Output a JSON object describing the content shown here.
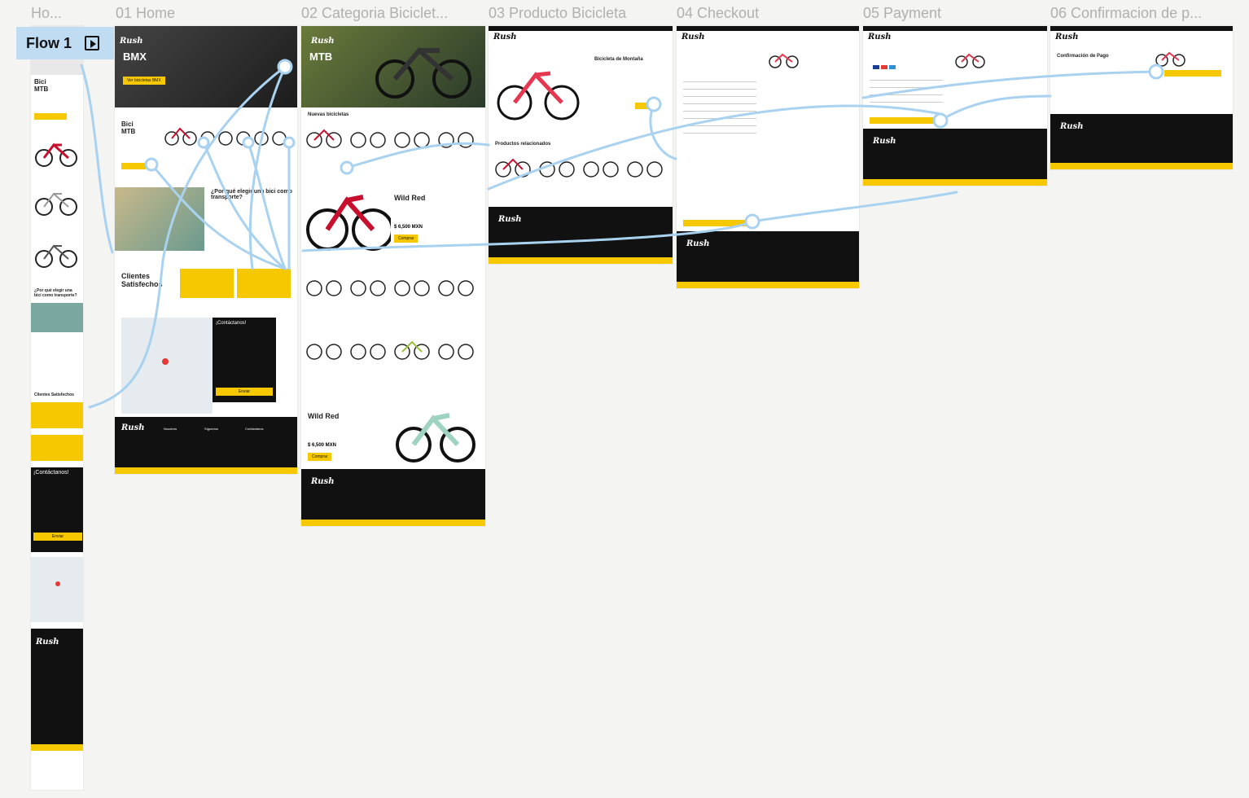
{
  "canvas": {
    "background": "#f4f4f3",
    "accent": "#f6c800",
    "flow_color": "#a9d2f0"
  },
  "flow": {
    "label": "Flow 1",
    "icon": "play-frame-icon"
  },
  "frames": [
    {
      "label": "Ho..."
    },
    {
      "label": "01 Home"
    },
    {
      "label": "02 Categoria Biciclet..."
    },
    {
      "label": "03 Producto Bicicleta"
    },
    {
      "label": "04 Checkout"
    },
    {
      "label": "05 Payment"
    },
    {
      "label": "06 Confirmacion de p..."
    }
  ],
  "brand": {
    "logo": "Rush"
  },
  "mobile": {
    "bici": "Bici",
    "mtb": "MTB",
    "why": "¿Por qué elegir una bici como transporte?",
    "clients": "Clientes Satisfechos",
    "contact": "¡Contáctanos!",
    "send": "Enviar"
  },
  "home": {
    "hero_title": "BMX",
    "hero_btn": "Ver bicicletas BMX",
    "bici": "Bici",
    "mtb": "MTB",
    "why": "¿Por qué elegir una bici como transporte?",
    "clients": "Clientes Satisfechos",
    "contact": "¡Contáctanos!",
    "send": "Enviar",
    "footer_nav": [
      "Nosotros",
      "Síguenos",
      "Contáctanos"
    ]
  },
  "category": {
    "hero_title": "MTB",
    "new_bikes": "Nuevas bicicletas",
    "feature_title": "Wild Red",
    "feature_price": "$ 6,500 MXN",
    "feature_btn": "Comprar",
    "feature2_title": "Wild Red",
    "feature2_price": "$ 6,500 MXN",
    "feature2_btn": "Comprar"
  },
  "product": {
    "title": "Bicicleta de Montaña",
    "related": "Productos relacionados"
  },
  "confirm": {
    "title": "Confirmación de Pago"
  }
}
